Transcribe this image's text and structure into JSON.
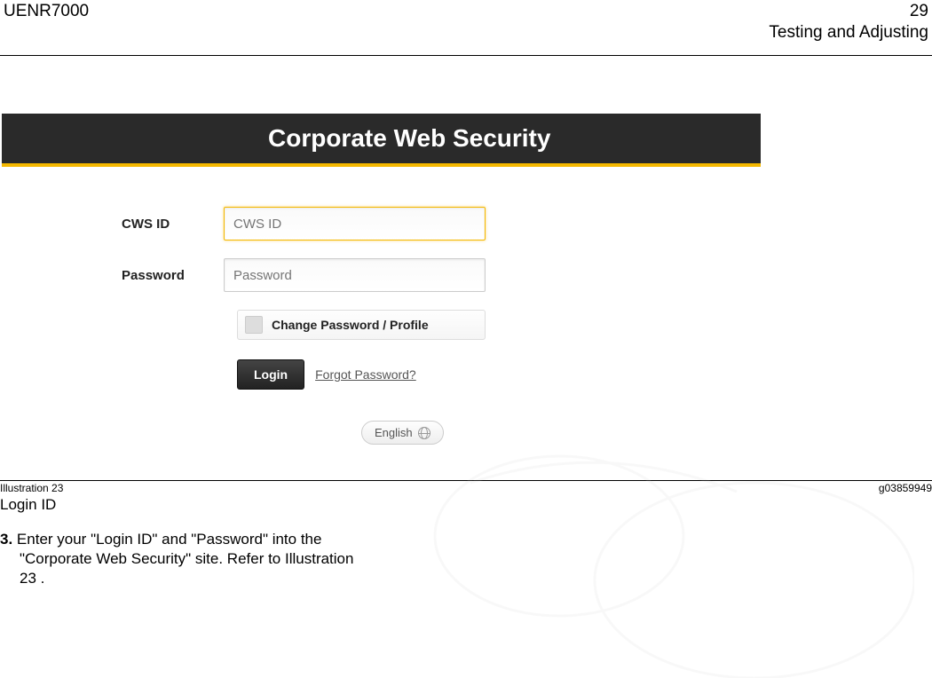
{
  "header": {
    "doc_code": "UENR7000",
    "page_number": "29",
    "section": "Testing and Adjusting"
  },
  "illustration": {
    "banner_title": "Corporate Web Security",
    "cws_label": "CWS ID",
    "cws_placeholder": "CWS ID",
    "password_label": "Password",
    "password_placeholder": "Password",
    "change_pw_label": "Change Password / Profile",
    "login_btn": "Login",
    "forgot_link": "Forgot Password?",
    "language": "English"
  },
  "footer": {
    "illustration_label": "Illustration 23",
    "graphic_code": "g03859949",
    "caption": "Login ID"
  },
  "step": {
    "number": "3.",
    "line1_a": "Enter your  \"Login ID\"  and  \"Password\"  into the",
    "line2": "\"Corporate Web Security\"  site. Refer to Illustration",
    "line3": "23 ."
  }
}
